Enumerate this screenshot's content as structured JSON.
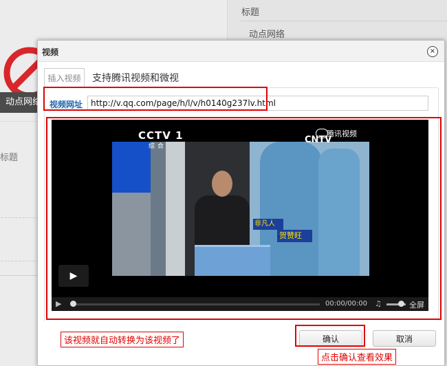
{
  "background": {
    "right_title": "标题",
    "right_sub": "动点网络",
    "left_bar": "动点网络",
    "left_title": "标题"
  },
  "dialog": {
    "title": "视频",
    "close_symbol": "×",
    "tab_label": "插入视频",
    "tab_note": "支持腾讯视频和微视",
    "url_label": "视频网址",
    "url_value": "http://v.qq.com/page/h/l/v/h0140g237lv.html",
    "confirm_label": "确认",
    "cancel_label": "取消"
  },
  "video": {
    "channel_logo": "CCTV 1",
    "channel_sub": "综合",
    "provider_logo": "腾讯视频",
    "provider_sub": "CNTV",
    "caption_line1": "非凡人",
    "caption_line2": "贺赞旺",
    "time": "00:00/00:00",
    "fullscreen_label": "全屏"
  },
  "annotations": {
    "left_note": "该视频就自动转换为该视频了",
    "right_note": "点击确认查看效果"
  },
  "colors": {
    "annotation_red": "#e00000",
    "label_blue": "#2266aa"
  }
}
